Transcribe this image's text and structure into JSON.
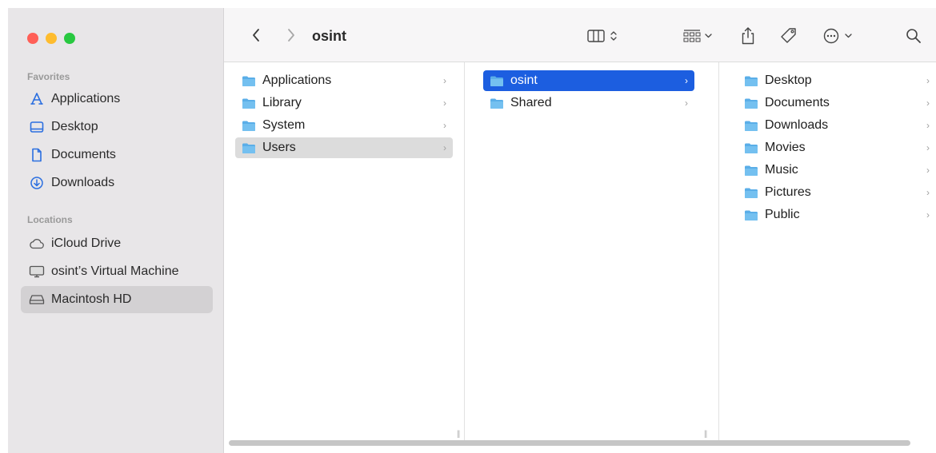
{
  "window": {
    "title": "osint"
  },
  "sidebar": {
    "favorites_heading": "Favorites",
    "favorites": [
      {
        "label": "Applications",
        "icon": "applications-icon"
      },
      {
        "label": "Desktop",
        "icon": "desktop-icon"
      },
      {
        "label": "Documents",
        "icon": "document-icon"
      },
      {
        "label": "Downloads",
        "icon": "download-icon"
      }
    ],
    "locations_heading": "Locations",
    "locations": [
      {
        "label": "iCloud Drive",
        "icon": "cloud-icon"
      },
      {
        "label": "osint’s Virtual Machine",
        "icon": "display-icon"
      },
      {
        "label": "Macintosh HD",
        "icon": "drive-icon",
        "selected": true
      }
    ]
  },
  "columns": [
    {
      "items": [
        {
          "label": "Applications"
        },
        {
          "label": "Library"
        },
        {
          "label": "System"
        },
        {
          "label": "Users",
          "selected": true
        }
      ]
    },
    {
      "items": [
        {
          "label": "osint",
          "selected": true
        },
        {
          "label": "Shared"
        }
      ]
    },
    {
      "items": [
        {
          "label": "Desktop"
        },
        {
          "label": "Documents"
        },
        {
          "label": "Downloads"
        },
        {
          "label": "Movies"
        },
        {
          "label": "Music"
        },
        {
          "label": "Pictures"
        },
        {
          "label": "Public"
        }
      ]
    }
  ],
  "colors": {
    "accent": "#1c5ee0",
    "folder": "#5aaee8",
    "sidebar_icon": "#2b6fe0"
  }
}
